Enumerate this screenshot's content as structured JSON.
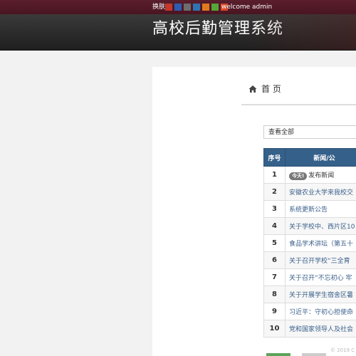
{
  "topbar": {
    "skin_label": "换肤",
    "swatches": [
      "#c0392b",
      "#2c5db0",
      "#6d6d6d",
      "#2f73b3",
      "#e07a1f",
      "#55a636",
      "#d9472b"
    ],
    "welcome": "welcome admin"
  },
  "header": {
    "title": "高校后勤管理系统"
  },
  "breadcrumb": {
    "home_icon": "home-icon",
    "label": "首 页"
  },
  "filter": {
    "selected": "查看全部"
  },
  "table": {
    "headers": [
      "序号",
      "新闻/公"
    ],
    "rows": [
      {
        "num": "1",
        "badge": "今天!",
        "title": "发布新闻"
      },
      {
        "num": "2",
        "title": "安徽农业大学来我校交"
      },
      {
        "num": "3",
        "title": "系统更新公告"
      },
      {
        "num": "4",
        "title": "关于学校中、西片区10"
      },
      {
        "num": "5",
        "title": "食品学术讲坛（第五十"
      },
      {
        "num": "6",
        "title": "关于召开学校“三全育"
      },
      {
        "num": "7",
        "title": "关于召开“不忘初心 牢"
      },
      {
        "num": "8",
        "title": "关于开展学生宿舍区暑"
      },
      {
        "num": "9",
        "title": "习近平：守初心担使命"
      },
      {
        "num": "10",
        "title": "党和国家领导人及社会"
      }
    ]
  },
  "footer": {
    "copyright": "© 2019 C"
  },
  "colors": {
    "topbar": "#4f1a26",
    "table_header": "#356089",
    "accent_green": "#5ca45c"
  }
}
